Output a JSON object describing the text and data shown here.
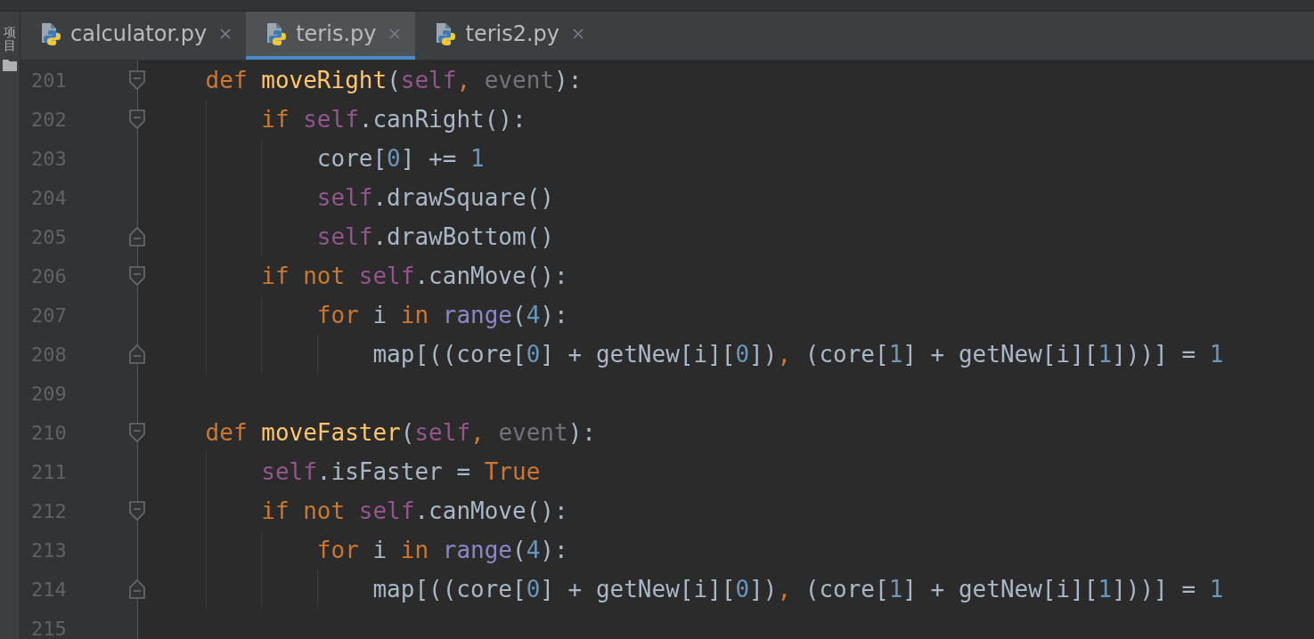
{
  "side_panel": {
    "label": "项目"
  },
  "tabs": [
    {
      "label": "calculator.py",
      "selected": false
    },
    {
      "label": "teris.py",
      "selected": true
    },
    {
      "label": "teris2.py",
      "selected": false
    }
  ],
  "editor": {
    "lines": [
      {
        "number": "201",
        "kind": "fold-start",
        "tokens": [
          {
            "t": "    def ",
            "kind": "keyword"
          },
          {
            "t": "moveRight",
            "kind": "function"
          },
          {
            "t": "(",
            "kind": "plain"
          },
          {
            "t": "self",
            "kind": "self"
          },
          {
            "t": ", ",
            "kind": "keyword"
          },
          {
            "t": "event",
            "kind": "param"
          },
          {
            "t": "):",
            "kind": "plain"
          }
        ]
      },
      {
        "number": "202",
        "kind": "fold-start",
        "tokens": [
          {
            "t": "        if ",
            "kind": "keyword"
          },
          {
            "t": "self",
            "kind": "self"
          },
          {
            "t": ".canRight():",
            "kind": "plain"
          }
        ]
      },
      {
        "number": "203",
        "kind": "plain",
        "tokens": [
          {
            "t": "            core[",
            "kind": "plain"
          },
          {
            "t": "0",
            "kind": "number"
          },
          {
            "t": "] += ",
            "kind": "plain"
          },
          {
            "t": "1",
            "kind": "number"
          }
        ]
      },
      {
        "number": "204",
        "kind": "plain",
        "tokens": [
          {
            "t": "            self",
            "kind": "self"
          },
          {
            "t": ".drawSquare()",
            "kind": "plain"
          }
        ]
      },
      {
        "number": "205",
        "kind": "fold-end",
        "tokens": [
          {
            "t": "            self",
            "kind": "self"
          },
          {
            "t": ".drawBottom()",
            "kind": "plain"
          }
        ]
      },
      {
        "number": "206",
        "kind": "fold-start",
        "tokens": [
          {
            "t": "        if not ",
            "kind": "keyword"
          },
          {
            "t": "self",
            "kind": "self"
          },
          {
            "t": ".canMove():",
            "kind": "plain"
          }
        ]
      },
      {
        "number": "207",
        "kind": "plain",
        "tokens": [
          {
            "t": "            for ",
            "kind": "keyword"
          },
          {
            "t": "i ",
            "kind": "plain"
          },
          {
            "t": "in ",
            "kind": "keyword"
          },
          {
            "t": "range",
            "kind": "builtin"
          },
          {
            "t": "(",
            "kind": "plain"
          },
          {
            "t": "4",
            "kind": "number"
          },
          {
            "t": "):",
            "kind": "plain"
          }
        ]
      },
      {
        "number": "208",
        "kind": "fold-end",
        "tokens": [
          {
            "t": "                map[((core[",
            "kind": "plain"
          },
          {
            "t": "0",
            "kind": "number"
          },
          {
            "t": "] + getNew[i][",
            "kind": "plain"
          },
          {
            "t": "0",
            "kind": "number"
          },
          {
            "t": "])",
            "kind": "plain"
          },
          {
            "t": ", ",
            "kind": "keyword"
          },
          {
            "t": "(core[",
            "kind": "plain"
          },
          {
            "t": "1",
            "kind": "number"
          },
          {
            "t": "] + getNew[i][",
            "kind": "plain"
          },
          {
            "t": "1",
            "kind": "number"
          },
          {
            "t": "]))] = ",
            "kind": "plain"
          },
          {
            "t": "1",
            "kind": "number"
          }
        ]
      },
      {
        "number": "209",
        "kind": "plain"
      },
      {
        "number": "210",
        "kind": "fold-start",
        "tokens": [
          {
            "t": "    def ",
            "kind": "keyword"
          },
          {
            "t": "moveFaster",
            "kind": "function"
          },
          {
            "t": "(",
            "kind": "plain"
          },
          {
            "t": "self",
            "kind": "self"
          },
          {
            "t": ", ",
            "kind": "keyword"
          },
          {
            "t": "event",
            "kind": "param"
          },
          {
            "t": "):",
            "kind": "plain"
          }
        ]
      },
      {
        "number": "211",
        "kind": "plain",
        "tokens": [
          {
            "t": "        self",
            "kind": "self"
          },
          {
            "t": ".isFaster = ",
            "kind": "plain"
          },
          {
            "t": "True",
            "kind": "keyword"
          }
        ]
      },
      {
        "number": "212",
        "kind": "fold-start",
        "tokens": [
          {
            "t": "        if not ",
            "kind": "keyword"
          },
          {
            "t": "self",
            "kind": "self"
          },
          {
            "t": ".canMove():",
            "kind": "plain"
          }
        ]
      },
      {
        "number": "213",
        "kind": "plain",
        "tokens": [
          {
            "t": "            for ",
            "kind": "keyword"
          },
          {
            "t": "i ",
            "kind": "plain"
          },
          {
            "t": "in ",
            "kind": "keyword"
          },
          {
            "t": "range",
            "kind": "builtin"
          },
          {
            "t": "(",
            "kind": "plain"
          },
          {
            "t": "4",
            "kind": "number"
          },
          {
            "t": "):",
            "kind": "plain"
          }
        ]
      },
      {
        "number": "214",
        "kind": "fold-end",
        "tokens": [
          {
            "t": "                map[((core[",
            "kind": "plain"
          },
          {
            "t": "0",
            "kind": "number"
          },
          {
            "t": "] + getNew[i][",
            "kind": "plain"
          },
          {
            "t": "0",
            "kind": "number"
          },
          {
            "t": "])",
            "kind": "plain"
          },
          {
            "t": ", ",
            "kind": "keyword"
          },
          {
            "t": "(core[",
            "kind": "plain"
          },
          {
            "t": "1",
            "kind": "number"
          },
          {
            "t": "] + getNew[i][",
            "kind": "plain"
          },
          {
            "t": "1",
            "kind": "number"
          },
          {
            "t": "]))] = ",
            "kind": "plain"
          },
          {
            "t": "1",
            "kind": "number"
          }
        ]
      },
      {
        "number": "215",
        "kind": "plain"
      }
    ]
  }
}
